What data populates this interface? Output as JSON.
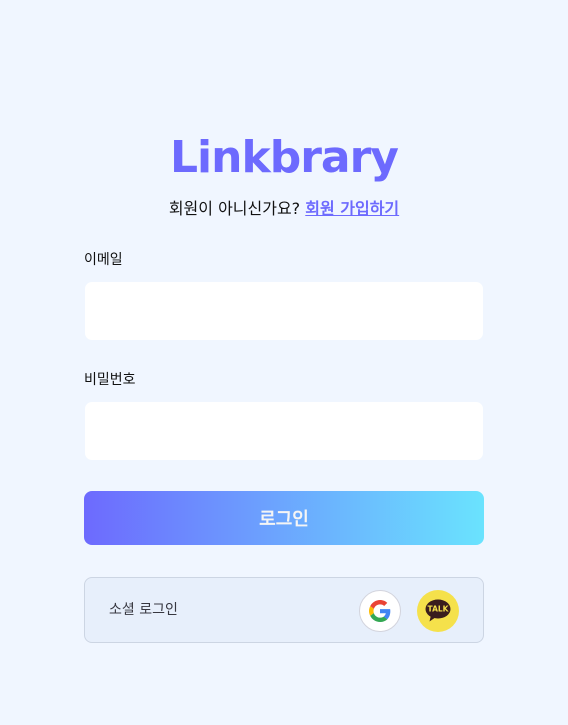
{
  "logo": {
    "text": "Linkbrary"
  },
  "signup": {
    "prompt": "회원이 아니신가요? ",
    "link": "회원 가입하기"
  },
  "email": {
    "label": "이메일",
    "value": "",
    "placeholder": ""
  },
  "password": {
    "label": "비밀번호",
    "value": "",
    "placeholder": ""
  },
  "login_button": {
    "label": "로그인"
  },
  "social": {
    "label": "소셜 로그인",
    "google_icon": "google-icon",
    "kakao_icon": "kakao-talk-icon",
    "kakao_text": "TALK"
  },
  "colors": {
    "brand": "#6d6afe",
    "background": "#f0f6ff",
    "gradient_start": "#6d6afe",
    "gradient_end": "#6ae3fe",
    "kakao_yellow": "#f5e14b"
  }
}
